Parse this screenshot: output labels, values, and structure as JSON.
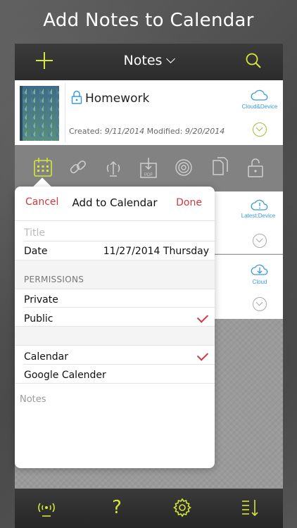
{
  "headline": "Add Notes to Calendar",
  "navbar": {
    "title": "Notes",
    "add_icon": "plus-icon",
    "search_icon": "search-icon"
  },
  "note": {
    "title": "Homework",
    "created_label": "Created:",
    "created_value": "9/11/2014",
    "modified_label": "Modified:",
    "modified_value": "9/20/2014",
    "sync_label": "Cloud&Device"
  },
  "rows": [
    {
      "sync_label": "Latest:Device"
    },
    {
      "sync_label": "Cloud"
    }
  ],
  "toolbar": {
    "icons": [
      "calendar-icon",
      "link-icon",
      "share-icon",
      "pdf-icon",
      "broadcast-icon",
      "copy-icon",
      "unlock-icon"
    ],
    "pdf_label": "PDF"
  },
  "popover": {
    "cancel_label": "Cancel",
    "title": "Add to Calendar",
    "done_label": "Done",
    "title_placeholder": "Title",
    "date_label": "Date",
    "date_value": "11/27/2014 Thursday",
    "permissions_header": "PERMISSIONS",
    "private_label": "Private",
    "public_label": "Public",
    "calendar_label": "Calendar",
    "google_label": "Google Calender",
    "notes_placeholder": "Notes"
  },
  "tabbar": {
    "icons": [
      "wireless-icon",
      "help-icon",
      "settings-icon",
      "sort-icon"
    ],
    "help_glyph": "?"
  },
  "colors": {
    "accent": "#d6e63a",
    "destructive": "#d0393e",
    "cloud_blue": "#3a9ad9"
  }
}
